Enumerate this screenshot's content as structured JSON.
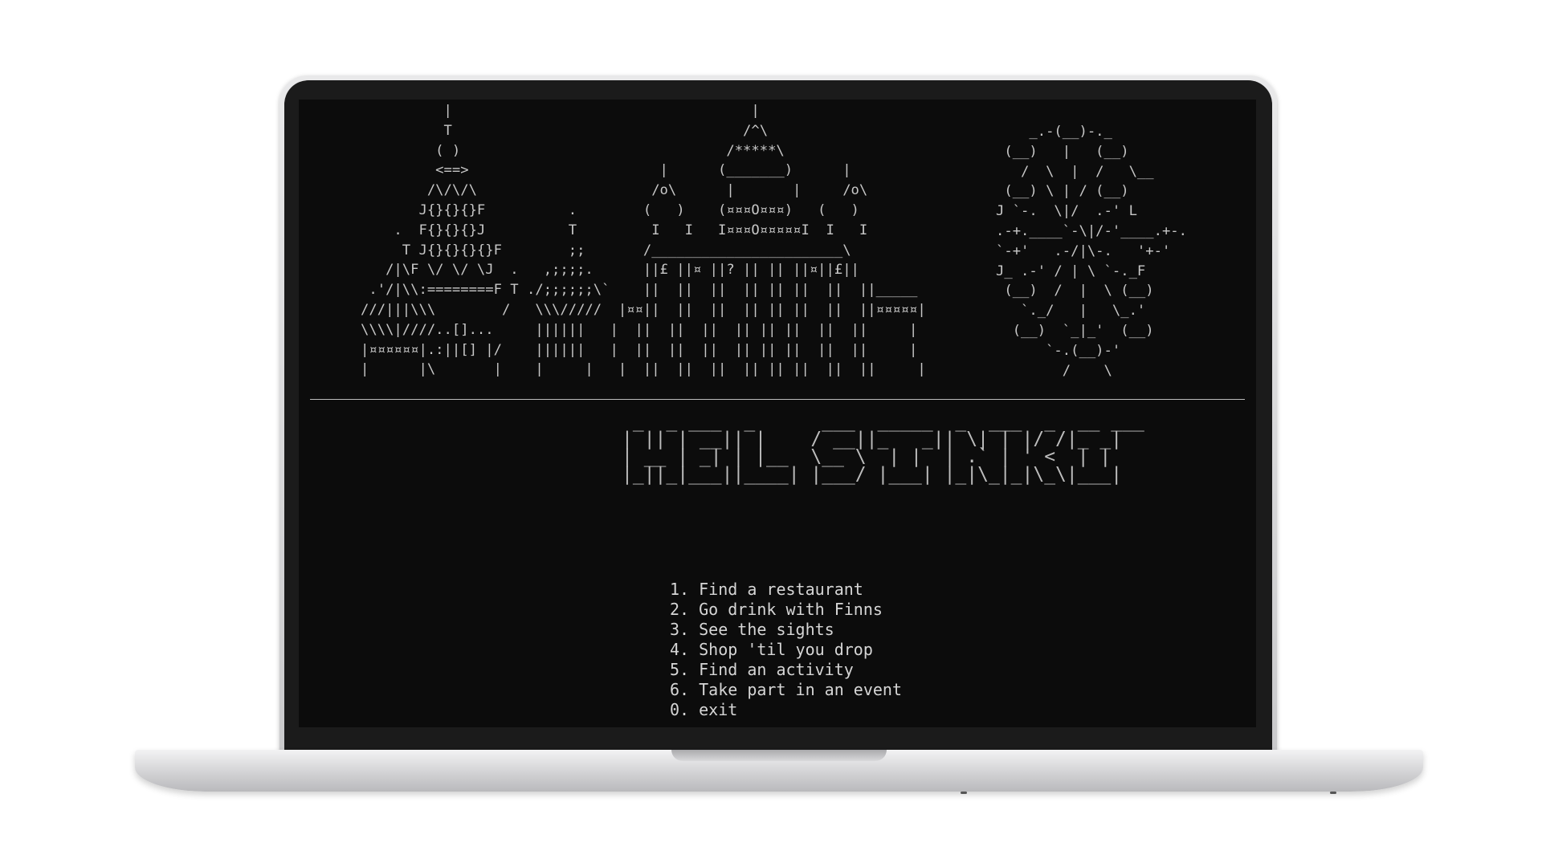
{
  "terminal": {
    "skyline_art": "             |                                    |\n             T                                   /^\\\n            ( )                                /*****\\\n            <==>                       |      (_______)      |\n           /\\/\\/\\                     /o\\      |       |     /o\\\n          J{}{}{}F          .        (   )    (¤¤¤O¤¤¤)   (   )\n       .  F{}{}{}J          T         I   I   I¤¤¤O¤¤¤¤¤I  I   I\n        T J{}{}{}{}F        ;;       /_______________________\\\n      /|\\F \\/ \\/ \\J  .   ,;;;;.      ||£ ||¤ ||? || || ||¤||£||\n    .'/|\\\\:========F T ./;;;;;;\\`    ||  ||  ||  || || ||  ||  ||_____\n   ///|||\\\\\\        /   \\\\\\/////  |¤¤||  ||  ||  || || ||  ||  ||¤¤¤¤¤|\n   \\\\\\\\|////..[]...     ||||||   |  ||  ||  ||  || || ||  ||  ||     |\n   |¤¤¤¤¤¤|.:||[] |/    ||||||   |  ||  ||  ||  || || ||  ||  ||     |\n   |      |\\       |    |     |   |  ||  ||  ||  || || ||  ||  ||     |",
    "wheel_art": "    _.-(__)-._\n (__)   |   (__)\n   /  \\  |  /   \\__\n (__) \\ | / (__)\nJ `-.  \\|/  .-' L\n.-+.____`-\\|/-'____.+-.\n`-+'   .-/|\\-.   '+-'\nJ_ .-' / | \\ `-._F\n (__)  /  |  \\ (__)\n   `._/   |   \\_.'\n  (__)  `_|_'  (__)\n      `-.(__)-'\n        /    \\",
    "title_art": " _  _ ___  _      ___  _____  _  ___  _  __ ___\n| || | __|| |    / __||_   _|| \\| | |/ /|_ _|\n| __ | _| | |__  \\__ \\  | |  | .` | ' <  | |\n|_||_|___||____| |___/ |___| |_|\\_|_|\\_\\|___|",
    "menu_items": [
      "1. Find a restaurant",
      "2. Go drink with Finns",
      "3. See the sights",
      "4. Shop 'til you drop",
      "5. Find an activity",
      "6. Take part in an event",
      "0. exit"
    ]
  }
}
